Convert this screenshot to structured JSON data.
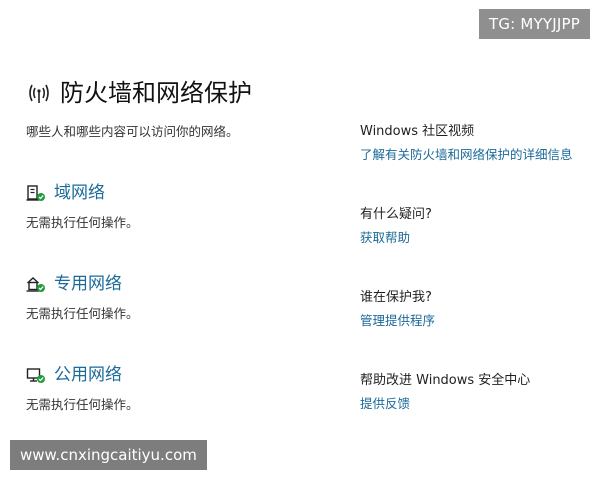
{
  "badge": "TG: MYYJJPP",
  "header": {
    "title": "防火墙和网络保护",
    "subtitle": "哪些人和哪些内容可以访问你的网络。"
  },
  "networks": [
    {
      "label": "域网络",
      "status": "无需执行任何操作。",
      "icon": "domain-network-icon"
    },
    {
      "label": "专用网络",
      "status": "无需执行任何操作。",
      "icon": "private-network-icon"
    },
    {
      "label": "公用网络",
      "status": "无需执行任何操作。",
      "icon": "public-network-icon"
    }
  ],
  "sidebar": {
    "sections": [
      {
        "heading": "Windows 社区视频",
        "link": "了解有关防火墙和网络保护的详细信息"
      },
      {
        "heading": "有什么疑问?",
        "link": "获取帮助"
      },
      {
        "heading": "谁在保护我?",
        "link": "管理提供程序"
      },
      {
        "heading": "帮助改进 Windows 安全中心",
        "link": "提供反馈"
      }
    ]
  },
  "watermark": "www.cnxingcaitiyu.com",
  "colors": {
    "link": "#1b6a9a",
    "badge_bg": "#8f8f8f",
    "status_ok": "#1e9e3a"
  }
}
